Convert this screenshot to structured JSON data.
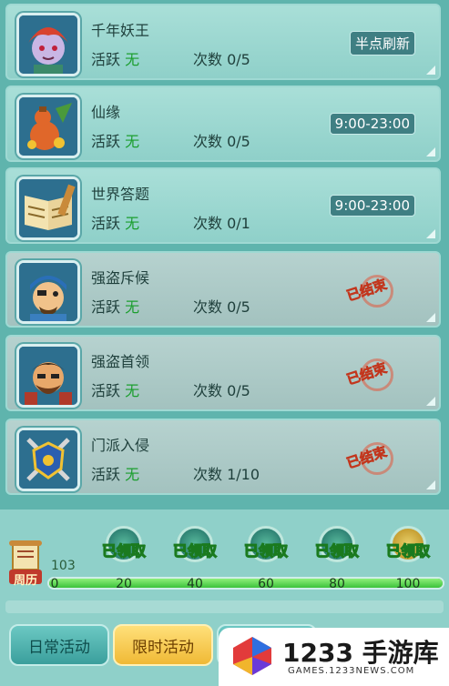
{
  "activities": [
    {
      "title": "千年妖王",
      "active_label": "活跃",
      "active_value": "无",
      "count_label": "次数",
      "count_value": "0/5",
      "schedule": "半点刷新",
      "status": "open",
      "avatar": "demon-king-portrait"
    },
    {
      "title": "仙缘",
      "active_label": "活跃",
      "active_value": "无",
      "count_label": "次数",
      "count_value": "0/5",
      "schedule": "9:00-23:00",
      "status": "open",
      "avatar": "treasure-gourd-icon"
    },
    {
      "title": "世界答题",
      "active_label": "活跃",
      "active_value": "无",
      "count_label": "次数",
      "count_value": "0/1",
      "schedule": "9:00-23:00",
      "status": "open",
      "avatar": "book-scroll-icon"
    },
    {
      "title": "强盗斥候",
      "active_label": "活跃",
      "active_value": "无",
      "count_label": "次数",
      "count_value": "0/5",
      "schedule": "已结束",
      "status": "ended",
      "avatar": "bandit-scout-portrait"
    },
    {
      "title": "强盗首领",
      "active_label": "活跃",
      "active_value": "无",
      "count_label": "次数",
      "count_value": "0/5",
      "schedule": "已结束",
      "status": "ended",
      "avatar": "bandit-chief-portrait"
    },
    {
      "title": "门派入侵",
      "active_label": "活跃",
      "active_value": "无",
      "count_label": "次数",
      "count_value": "1/10",
      "schedule": "已结束",
      "status": "ended",
      "avatar": "crossed-swords-shield-icon"
    }
  ],
  "progress": {
    "calendar_label": "周历",
    "score": "103",
    "score_value": 103,
    "max": 100,
    "milestones": [
      {
        "value": 20,
        "label": "20",
        "reward": "已领取"
      },
      {
        "value": 40,
        "label": "40",
        "reward": "已领取"
      },
      {
        "value": 60,
        "label": "60",
        "reward": "已领取"
      },
      {
        "value": 80,
        "label": "80",
        "reward": "已领取"
      },
      {
        "value": 100,
        "label": "100",
        "reward": "已领取"
      }
    ],
    "zero_label": "0"
  },
  "tabs": {
    "daily": "日常活动",
    "limited": "限时活动"
  },
  "watermark": {
    "brand": "1233 手游库",
    "url": "GAMES.1233NEWS.COM"
  },
  "colors": {
    "active_value": "#1b9e2e",
    "ended_stamp": "#ff8a66",
    "progress_fill": "#3cc23b"
  }
}
